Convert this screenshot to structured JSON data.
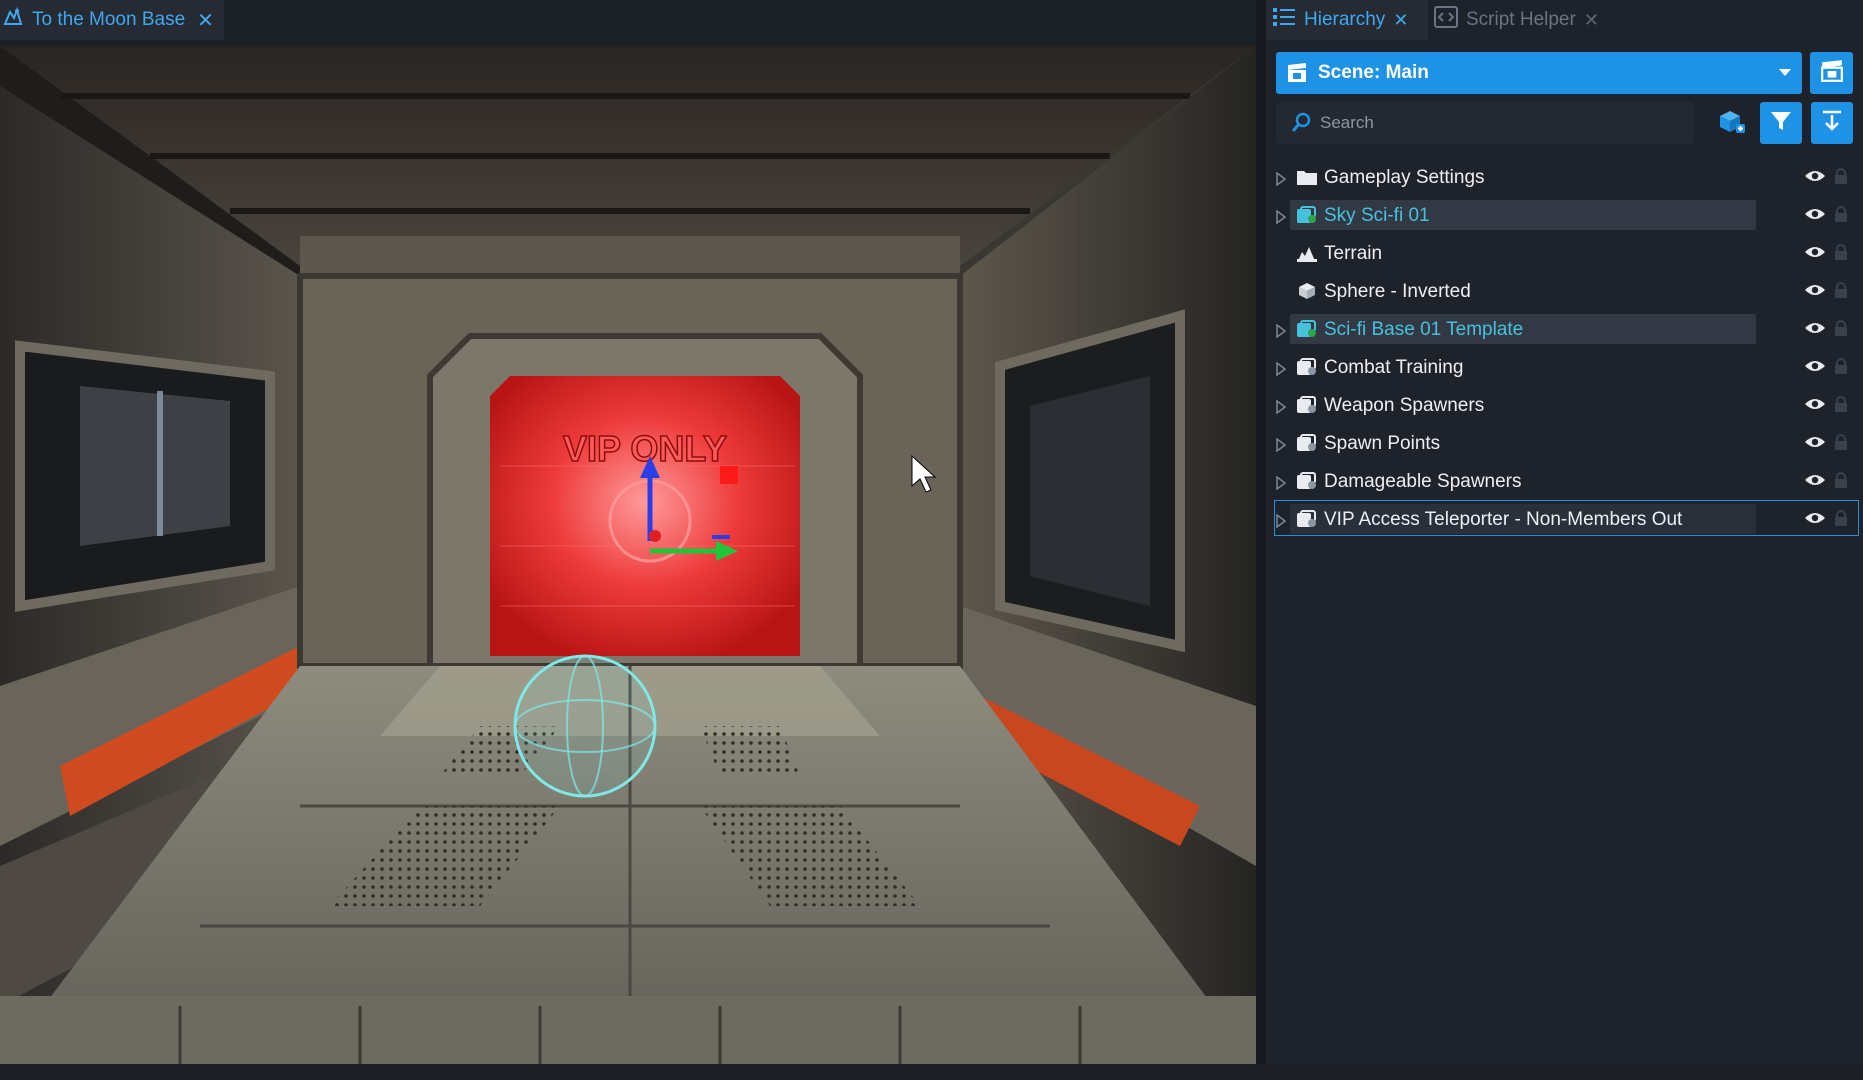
{
  "viewport": {
    "tab_label": "To the Moon Base",
    "close_glyph": "✕",
    "sign_text": "VIP ONLY"
  },
  "hierarchy": {
    "tabs": [
      {
        "label": "Hierarchy",
        "active": true,
        "icon": "list-icon"
      },
      {
        "label": "Script Helper",
        "active": false,
        "icon": "code-icon"
      }
    ],
    "close_glyph": "✕",
    "scene_label": "Scene: Main",
    "search_placeholder": "Search",
    "colors": {
      "accent": "#1e93e6",
      "teal_text": "#46c2dc",
      "panel_bg": "#1e222a",
      "selection_border": "#2f8ed8"
    },
    "items": [
      {
        "label": "Gameplay Settings",
        "icon": "folder-icon",
        "expandable": true,
        "style": "normal"
      },
      {
        "label": "Sky Sci-fi 01",
        "icon": "template-teal-icon",
        "expandable": true,
        "style": "teal-highlight"
      },
      {
        "label": "Terrain",
        "icon": "terrain-icon",
        "expandable": false,
        "style": "normal"
      },
      {
        "label": "Sphere - Inverted",
        "icon": "cube-icon",
        "expandable": false,
        "style": "normal"
      },
      {
        "label": "Sci-fi Base 01 Template",
        "icon": "template-teal-icon",
        "expandable": true,
        "style": "teal-highlight"
      },
      {
        "label": "Combat Training",
        "icon": "group-icon",
        "expandable": true,
        "style": "normal"
      },
      {
        "label": "Weapon Spawners",
        "icon": "group-icon",
        "expandable": true,
        "style": "normal"
      },
      {
        "label": "Spawn Points",
        "icon": "group-icon",
        "expandable": true,
        "style": "normal"
      },
      {
        "label": "Damageable Spawners",
        "icon": "group-icon",
        "expandable": true,
        "style": "normal"
      },
      {
        "label": "VIP Access Teleporter - Non-Members Out",
        "icon": "group-icon",
        "expandable": true,
        "style": "selected"
      }
    ]
  }
}
